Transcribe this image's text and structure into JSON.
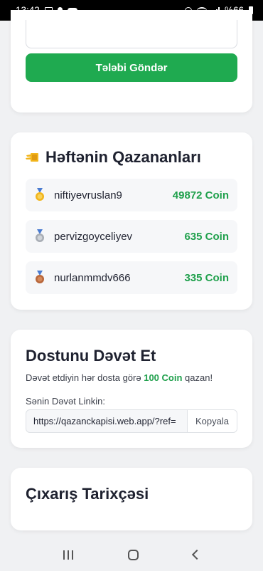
{
  "status_bar": {
    "time": "13:42",
    "battery": "%66"
  },
  "form": {
    "submit_label": "Tələbi Göndər"
  },
  "winners": {
    "title": "Həftənin Qazananları",
    "rows": [
      {
        "username": "niftiyevruslan9",
        "coins": "49872 Coin",
        "medal": "gold"
      },
      {
        "username": "pervizgoyceliyev",
        "coins": "635 Coin",
        "medal": "silver"
      },
      {
        "username": "nurlanmmdv666",
        "coins": "335 Coin",
        "medal": "bronze"
      }
    ]
  },
  "invite": {
    "title": "Dostunu Dəvət Et",
    "desc_before": "Dəvət etdiyin hər dosta görə ",
    "desc_highlight": "100 Coin",
    "desc_after": " qazan!",
    "link_label": "Sənin Dəvət Linkin:",
    "link_value": "https://qazanckapisi.web.app/?ref=",
    "copy_label": "Kopyala"
  },
  "history": {
    "title": "Çıxarış Tarixçəsi"
  },
  "colors": {
    "accent_green": "#1faa50",
    "coin_green": "#1fa04c",
    "gold": "#f2b51c",
    "silver": "#a8adb5",
    "bronze": "#b8663a"
  }
}
